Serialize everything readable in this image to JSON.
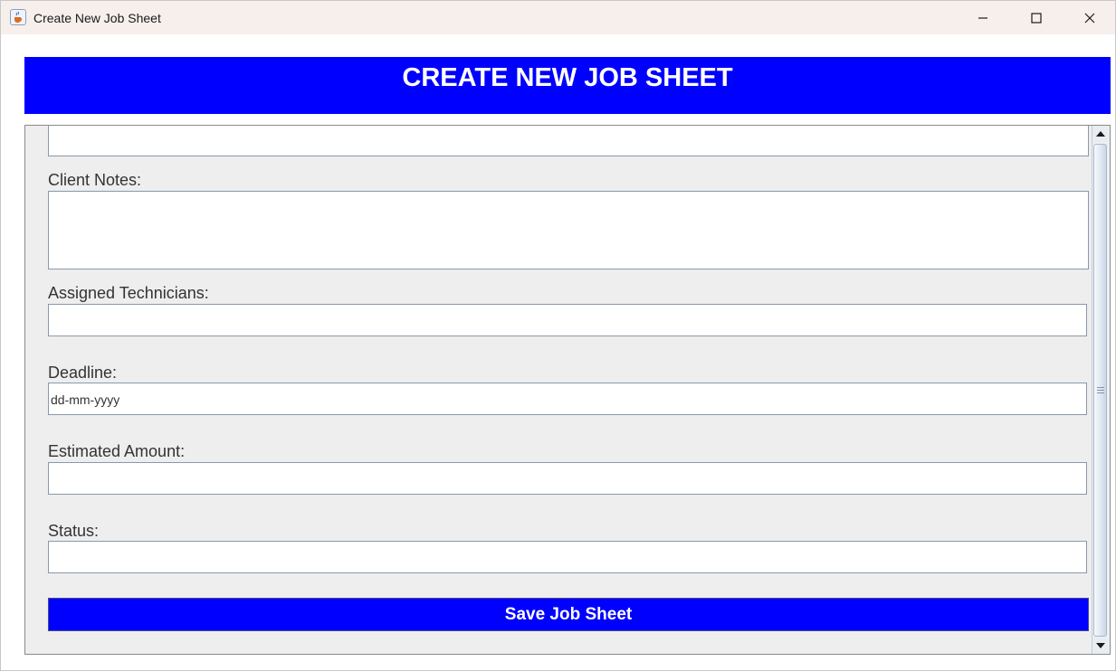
{
  "window": {
    "title": "Create New Job Sheet",
    "icon": "java-cup-icon",
    "controls": [
      "minimize-icon",
      "maximize-icon",
      "close-icon"
    ]
  },
  "header": {
    "title": "CREATE NEW JOB SHEET",
    "background": "#0000ff",
    "text_color": "#ffffff"
  },
  "form": {
    "client_notes": {
      "label": "Client Notes:",
      "value": ""
    },
    "assigned_technicians": {
      "label": "Assigned Technicians:",
      "value": ""
    },
    "deadline": {
      "label": "Deadline:",
      "value": "dd-mm-yyyy"
    },
    "estimated_amount": {
      "label": "Estimated Amount:",
      "value": ""
    },
    "status": {
      "label": "Status:",
      "value": ""
    }
  },
  "save_button": {
    "label": "Save Job Sheet",
    "background": "#0000ff"
  }
}
